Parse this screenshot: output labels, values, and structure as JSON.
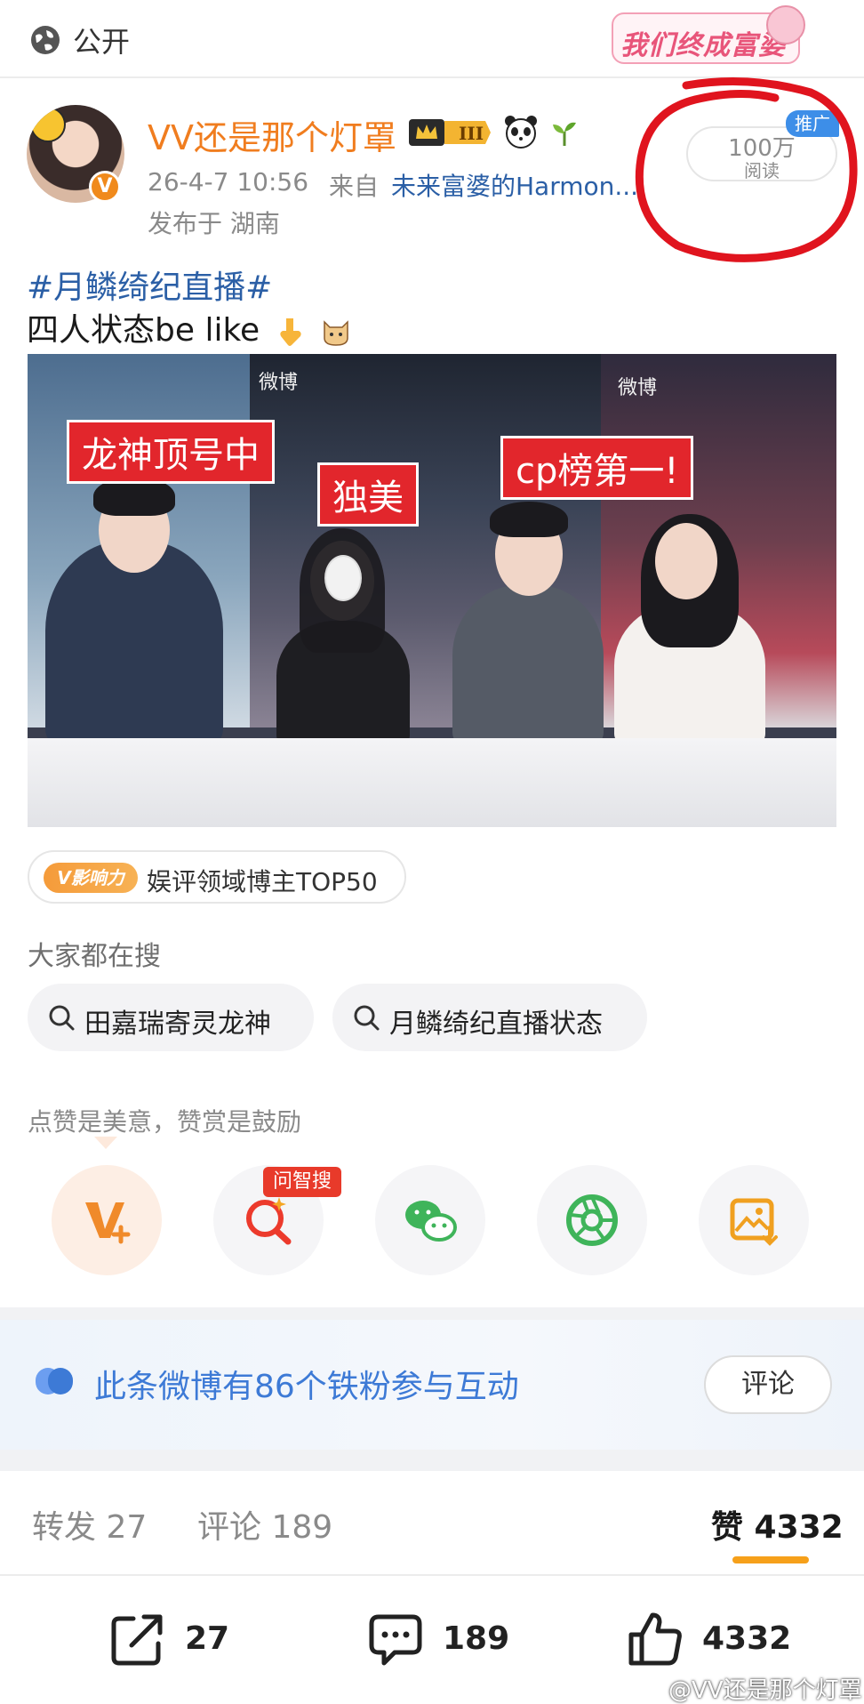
{
  "topbar": {
    "visibility": "公开",
    "theme_badge": "我们终成富婆"
  },
  "author": {
    "name": "VV还是那个灯罩",
    "verified_mark": "V",
    "time": "26-4-7 10:56",
    "from_label": "来自",
    "source": "未来富婆的Harmon...",
    "location": "发布于 湖南",
    "reads": "100万",
    "reads_label": "阅读",
    "promo": "推广"
  },
  "post": {
    "hashtag": "#月鳞绮纪直播#",
    "text": "四人状态be like",
    "photo_captions": [
      "龙神顶号中",
      "独美",
      "cp榜第一!"
    ],
    "photo_logo": "微博"
  },
  "influence": {
    "tag": "V影响力",
    "text": "娱评领域博主TOP50"
  },
  "search": {
    "title": "大家都在搜",
    "chips": [
      "田嘉瑞寄灵龙神",
      "月鳞绮纪直播状态"
    ]
  },
  "reward": {
    "text": "点赞是美意，赞赏是鼓励",
    "wenzhisou": "问智搜",
    "actions": [
      "v-plus-icon",
      "ai-search-icon",
      "wechat-icon",
      "moments-icon",
      "save-image-icon"
    ]
  },
  "fans": {
    "text": "此条微博有86个铁粉参与互动",
    "button": "评论"
  },
  "tabs": {
    "repost": "转发 27",
    "comments": "评论 189",
    "likes": "赞 4332"
  },
  "bottom_bar": {
    "repost": "27",
    "comment": "189",
    "like": "4332"
  },
  "watermark": "@VV还是那个灯罩",
  "colors": {
    "brand_orange": "#f07d1f",
    "link_blue": "#2b5fa6",
    "red_marker": "#e0141e"
  }
}
